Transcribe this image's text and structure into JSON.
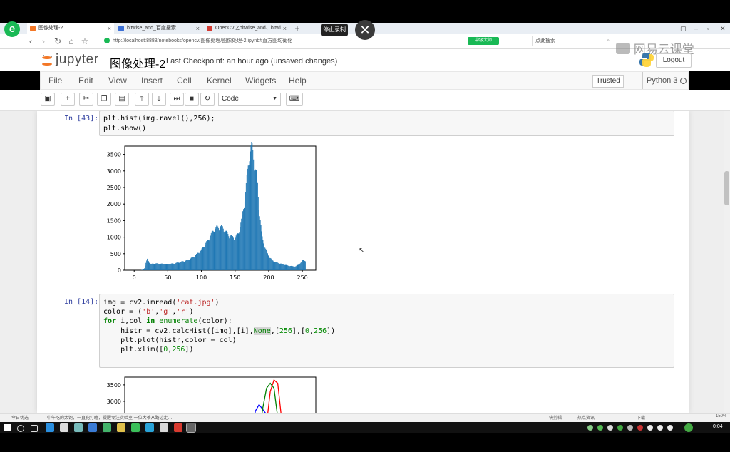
{
  "recording": {
    "stop_label": "停止录制"
  },
  "browser": {
    "tabs": [
      {
        "label": "图像处理-2",
        "active": true
      },
      {
        "label": "bitwise_and_百度搜索",
        "active": false
      },
      {
        "label": "OpenCV之bitwise_and、bitwi",
        "active": false
      }
    ],
    "url": "http://localhost:8888/notebooks/opencv/图像处理/图像处理-2.ipynb#直方图均衡化",
    "speed_badge": "中级大师",
    "search_label": "点此搜索"
  },
  "notebook": {
    "logo_text": "jupyter",
    "title": "图像处理-2",
    "checkpoint": "Last Checkpoint: an hour ago (unsaved changes)",
    "logout_label": "Logout",
    "menus": [
      "File",
      "Edit",
      "View",
      "Insert",
      "Cell",
      "Kernel",
      "Widgets",
      "Help"
    ],
    "trusted_label": "Trusted",
    "kernel_label": "Python 3",
    "cell_type": "Code"
  },
  "watermark": {
    "text": "网易云课堂"
  },
  "cells": [
    {
      "prompt": "In [43]:",
      "lines": [
        "plt.hist(img.ravel(),256);",
        "plt.show()"
      ]
    },
    {
      "prompt": "In [14]:",
      "lines": [
        "img = cv2.imread('cat.jpg')",
        "color = ('b','g','r')",
        "for i,col in enumerate(color):",
        "    histr = cv2.calcHist([img],[i],None,[256],[0,256])",
        "    plt.plot(histr,color = col)",
        "    plt.xlim([0,256])"
      ]
    }
  ],
  "chart_data": [
    {
      "type": "bar",
      "title": "",
      "xlabel": "",
      "ylabel": "",
      "xlim": [
        -14,
        270
      ],
      "ylim": [
        0,
        3750
      ],
      "xticks": [
        0,
        50,
        100,
        150,
        200,
        250
      ],
      "yticks": [
        0,
        500,
        1000,
        1500,
        2000,
        2500,
        3000,
        3500
      ],
      "color": "#1f77b4",
      "x": [
        0,
        5,
        10,
        15,
        18,
        20,
        22,
        25,
        30,
        40,
        50,
        60,
        70,
        80,
        90,
        100,
        110,
        120,
        130,
        140,
        150,
        155,
        160,
        165,
        170,
        172,
        175,
        177,
        180,
        183,
        185,
        188,
        190,
        195,
        200,
        205,
        210,
        220,
        230,
        240,
        248,
        252,
        255
      ],
      "values": [
        0,
        0,
        0,
        30,
        250,
        350,
        250,
        180,
        200,
        190,
        180,
        200,
        250,
        300,
        420,
        600,
        900,
        1250,
        1300,
        1050,
        950,
        1100,
        1500,
        2200,
        3200,
        3550,
        3650,
        3450,
        3000,
        2700,
        2000,
        1400,
        1000,
        650,
        420,
        300,
        240,
        180,
        130,
        110,
        220,
        330,
        250
      ]
    },
    {
      "type": "line",
      "title": "",
      "xlabel": "",
      "ylabel": "",
      "xlim": [
        0,
        256
      ],
      "yticks": [
        3000,
        3500
      ],
      "series": [
        {
          "color": "b",
          "x": [
            170,
            175,
            180,
            185,
            190
          ],
          "values": [
            2000,
            2700,
            2900,
            2750,
            2600
          ]
        },
        {
          "color": "g",
          "x": [
            180,
            185,
            190,
            195,
            200,
            205
          ],
          "values": [
            2000,
            2800,
            3400,
            3550,
            3400,
            2500
          ]
        },
        {
          "color": "r",
          "x": [
            190,
            195,
            200,
            205,
            210
          ],
          "values": [
            2300,
            3300,
            3650,
            3550,
            2500
          ]
        }
      ]
    }
  ],
  "statusbar": {
    "left_text": "今日优选",
    "news": "中午吃的太饱，一直犯打瞌，提醒专注实验室 一位大爷从路边走…",
    "right_items": [
      "快剪辑",
      "热点资讯",
      "下载",
      "150%"
    ]
  },
  "taskbar": {
    "time": "0:04"
  }
}
